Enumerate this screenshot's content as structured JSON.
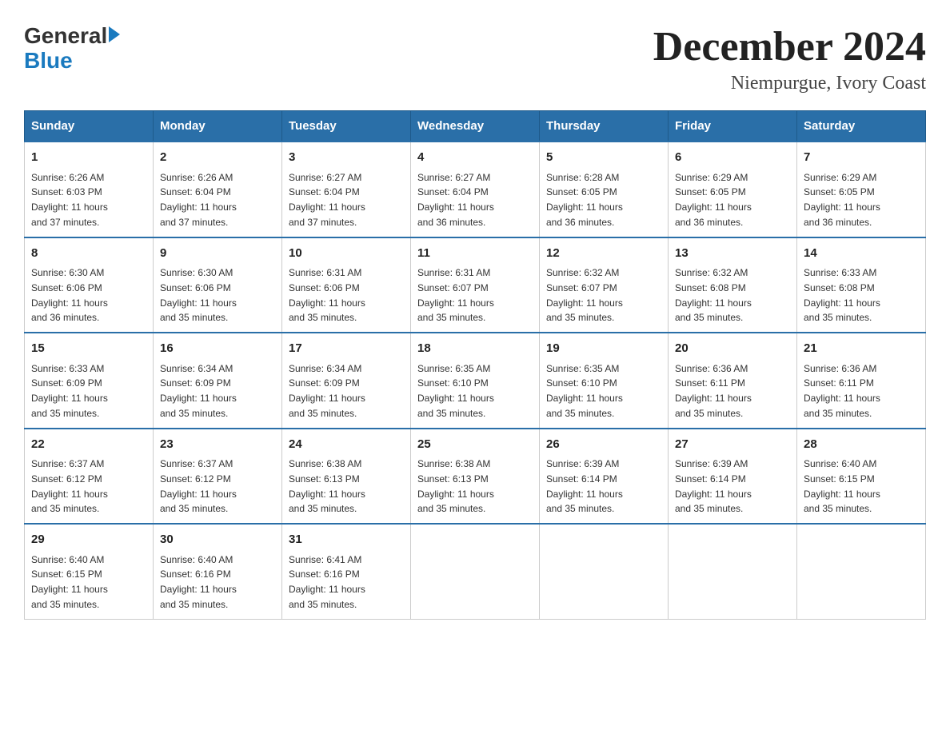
{
  "header": {
    "logo_general": "General",
    "logo_blue": "Blue",
    "main_title": "December 2024",
    "subtitle": "Niempurgue, Ivory Coast"
  },
  "calendar": {
    "days": [
      "Sunday",
      "Monday",
      "Tuesday",
      "Wednesday",
      "Thursday",
      "Friday",
      "Saturday"
    ],
    "weeks": [
      [
        {
          "day": "1",
          "sunrise": "6:26 AM",
          "sunset": "6:03 PM",
          "daylight": "11 hours and 37 minutes."
        },
        {
          "day": "2",
          "sunrise": "6:26 AM",
          "sunset": "6:04 PM",
          "daylight": "11 hours and 37 minutes."
        },
        {
          "day": "3",
          "sunrise": "6:27 AM",
          "sunset": "6:04 PM",
          "daylight": "11 hours and 37 minutes."
        },
        {
          "day": "4",
          "sunrise": "6:27 AM",
          "sunset": "6:04 PM",
          "daylight": "11 hours and 36 minutes."
        },
        {
          "day": "5",
          "sunrise": "6:28 AM",
          "sunset": "6:05 PM",
          "daylight": "11 hours and 36 minutes."
        },
        {
          "day": "6",
          "sunrise": "6:29 AM",
          "sunset": "6:05 PM",
          "daylight": "11 hours and 36 minutes."
        },
        {
          "day": "7",
          "sunrise": "6:29 AM",
          "sunset": "6:05 PM",
          "daylight": "11 hours and 36 minutes."
        }
      ],
      [
        {
          "day": "8",
          "sunrise": "6:30 AM",
          "sunset": "6:06 PM",
          "daylight": "11 hours and 36 minutes."
        },
        {
          "day": "9",
          "sunrise": "6:30 AM",
          "sunset": "6:06 PM",
          "daylight": "11 hours and 35 minutes."
        },
        {
          "day": "10",
          "sunrise": "6:31 AM",
          "sunset": "6:06 PM",
          "daylight": "11 hours and 35 minutes."
        },
        {
          "day": "11",
          "sunrise": "6:31 AM",
          "sunset": "6:07 PM",
          "daylight": "11 hours and 35 minutes."
        },
        {
          "day": "12",
          "sunrise": "6:32 AM",
          "sunset": "6:07 PM",
          "daylight": "11 hours and 35 minutes."
        },
        {
          "day": "13",
          "sunrise": "6:32 AM",
          "sunset": "6:08 PM",
          "daylight": "11 hours and 35 minutes."
        },
        {
          "day": "14",
          "sunrise": "6:33 AM",
          "sunset": "6:08 PM",
          "daylight": "11 hours and 35 minutes."
        }
      ],
      [
        {
          "day": "15",
          "sunrise": "6:33 AM",
          "sunset": "6:09 PM",
          "daylight": "11 hours and 35 minutes."
        },
        {
          "day": "16",
          "sunrise": "6:34 AM",
          "sunset": "6:09 PM",
          "daylight": "11 hours and 35 minutes."
        },
        {
          "day": "17",
          "sunrise": "6:34 AM",
          "sunset": "6:09 PM",
          "daylight": "11 hours and 35 minutes."
        },
        {
          "day": "18",
          "sunrise": "6:35 AM",
          "sunset": "6:10 PM",
          "daylight": "11 hours and 35 minutes."
        },
        {
          "day": "19",
          "sunrise": "6:35 AM",
          "sunset": "6:10 PM",
          "daylight": "11 hours and 35 minutes."
        },
        {
          "day": "20",
          "sunrise": "6:36 AM",
          "sunset": "6:11 PM",
          "daylight": "11 hours and 35 minutes."
        },
        {
          "day": "21",
          "sunrise": "6:36 AM",
          "sunset": "6:11 PM",
          "daylight": "11 hours and 35 minutes."
        }
      ],
      [
        {
          "day": "22",
          "sunrise": "6:37 AM",
          "sunset": "6:12 PM",
          "daylight": "11 hours and 35 minutes."
        },
        {
          "day": "23",
          "sunrise": "6:37 AM",
          "sunset": "6:12 PM",
          "daylight": "11 hours and 35 minutes."
        },
        {
          "day": "24",
          "sunrise": "6:38 AM",
          "sunset": "6:13 PM",
          "daylight": "11 hours and 35 minutes."
        },
        {
          "day": "25",
          "sunrise": "6:38 AM",
          "sunset": "6:13 PM",
          "daylight": "11 hours and 35 minutes."
        },
        {
          "day": "26",
          "sunrise": "6:39 AM",
          "sunset": "6:14 PM",
          "daylight": "11 hours and 35 minutes."
        },
        {
          "day": "27",
          "sunrise": "6:39 AM",
          "sunset": "6:14 PM",
          "daylight": "11 hours and 35 minutes."
        },
        {
          "day": "28",
          "sunrise": "6:40 AM",
          "sunset": "6:15 PM",
          "daylight": "11 hours and 35 minutes."
        }
      ],
      [
        {
          "day": "29",
          "sunrise": "6:40 AM",
          "sunset": "6:15 PM",
          "daylight": "11 hours and 35 minutes."
        },
        {
          "day": "30",
          "sunrise": "6:40 AM",
          "sunset": "6:16 PM",
          "daylight": "11 hours and 35 minutes."
        },
        {
          "day": "31",
          "sunrise": "6:41 AM",
          "sunset": "6:16 PM",
          "daylight": "11 hours and 35 minutes."
        },
        null,
        null,
        null,
        null
      ]
    ],
    "labels": {
      "sunrise": "Sunrise:",
      "sunset": "Sunset:",
      "daylight": "Daylight:"
    }
  }
}
